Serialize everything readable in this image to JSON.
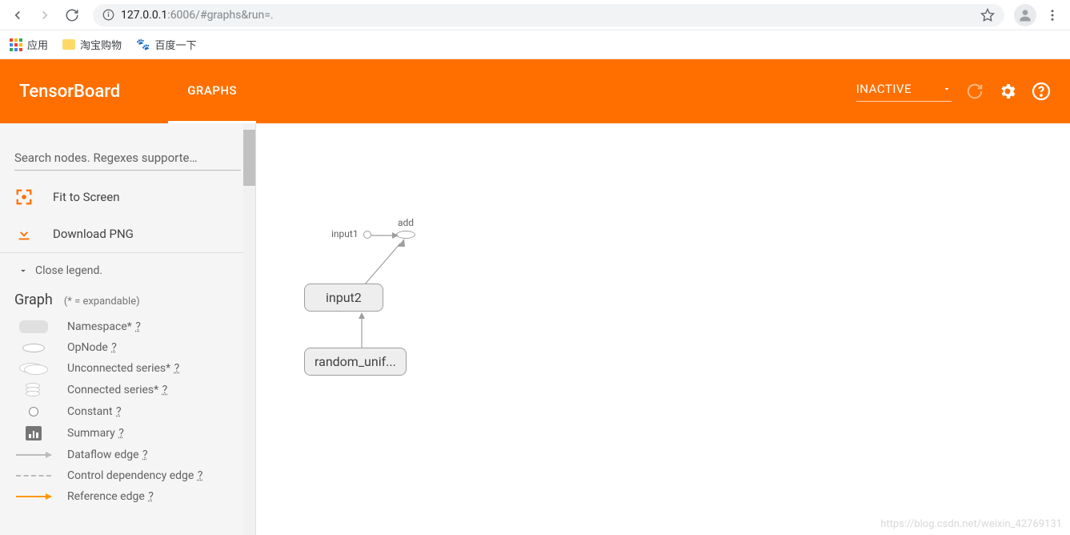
{
  "browser": {
    "url_host": "127.0.0.1",
    "url_port": ":6006",
    "url_path": "/#graphs&run=.",
    "bookmarks": {
      "apps": "应用",
      "taobao": "淘宝购物",
      "baidu": "百度一下"
    }
  },
  "header": {
    "title": "TensorBoard",
    "tabs": [
      {
        "label": "GRAPHS",
        "active": true
      }
    ],
    "dropdown": "INACTIVE"
  },
  "sidebar": {
    "search_placeholder": "Search nodes. Regexes supporte…",
    "fit_label": "Fit to Screen",
    "download_label": "Download PNG",
    "close_legend": "Close legend.",
    "graph_title": "Graph",
    "graph_hint": "(* = expandable)",
    "legend": {
      "namespace": "Namespace*",
      "opnode": "OpNode",
      "unconn": "Unconnected series*",
      "conn": "Connected series*",
      "constant": "Constant",
      "summary": "Summary",
      "dataflow": "Dataflow edge",
      "ctrl": "Control dependency edge",
      "ref": "Reference edge",
      "q": "?"
    }
  },
  "graph": {
    "nodes": {
      "input1": "input1",
      "add": "add",
      "input2": "input2",
      "random_uniform": "random_unif..."
    }
  },
  "watermark": "https://blog.csdn.net/weixin_42769131"
}
